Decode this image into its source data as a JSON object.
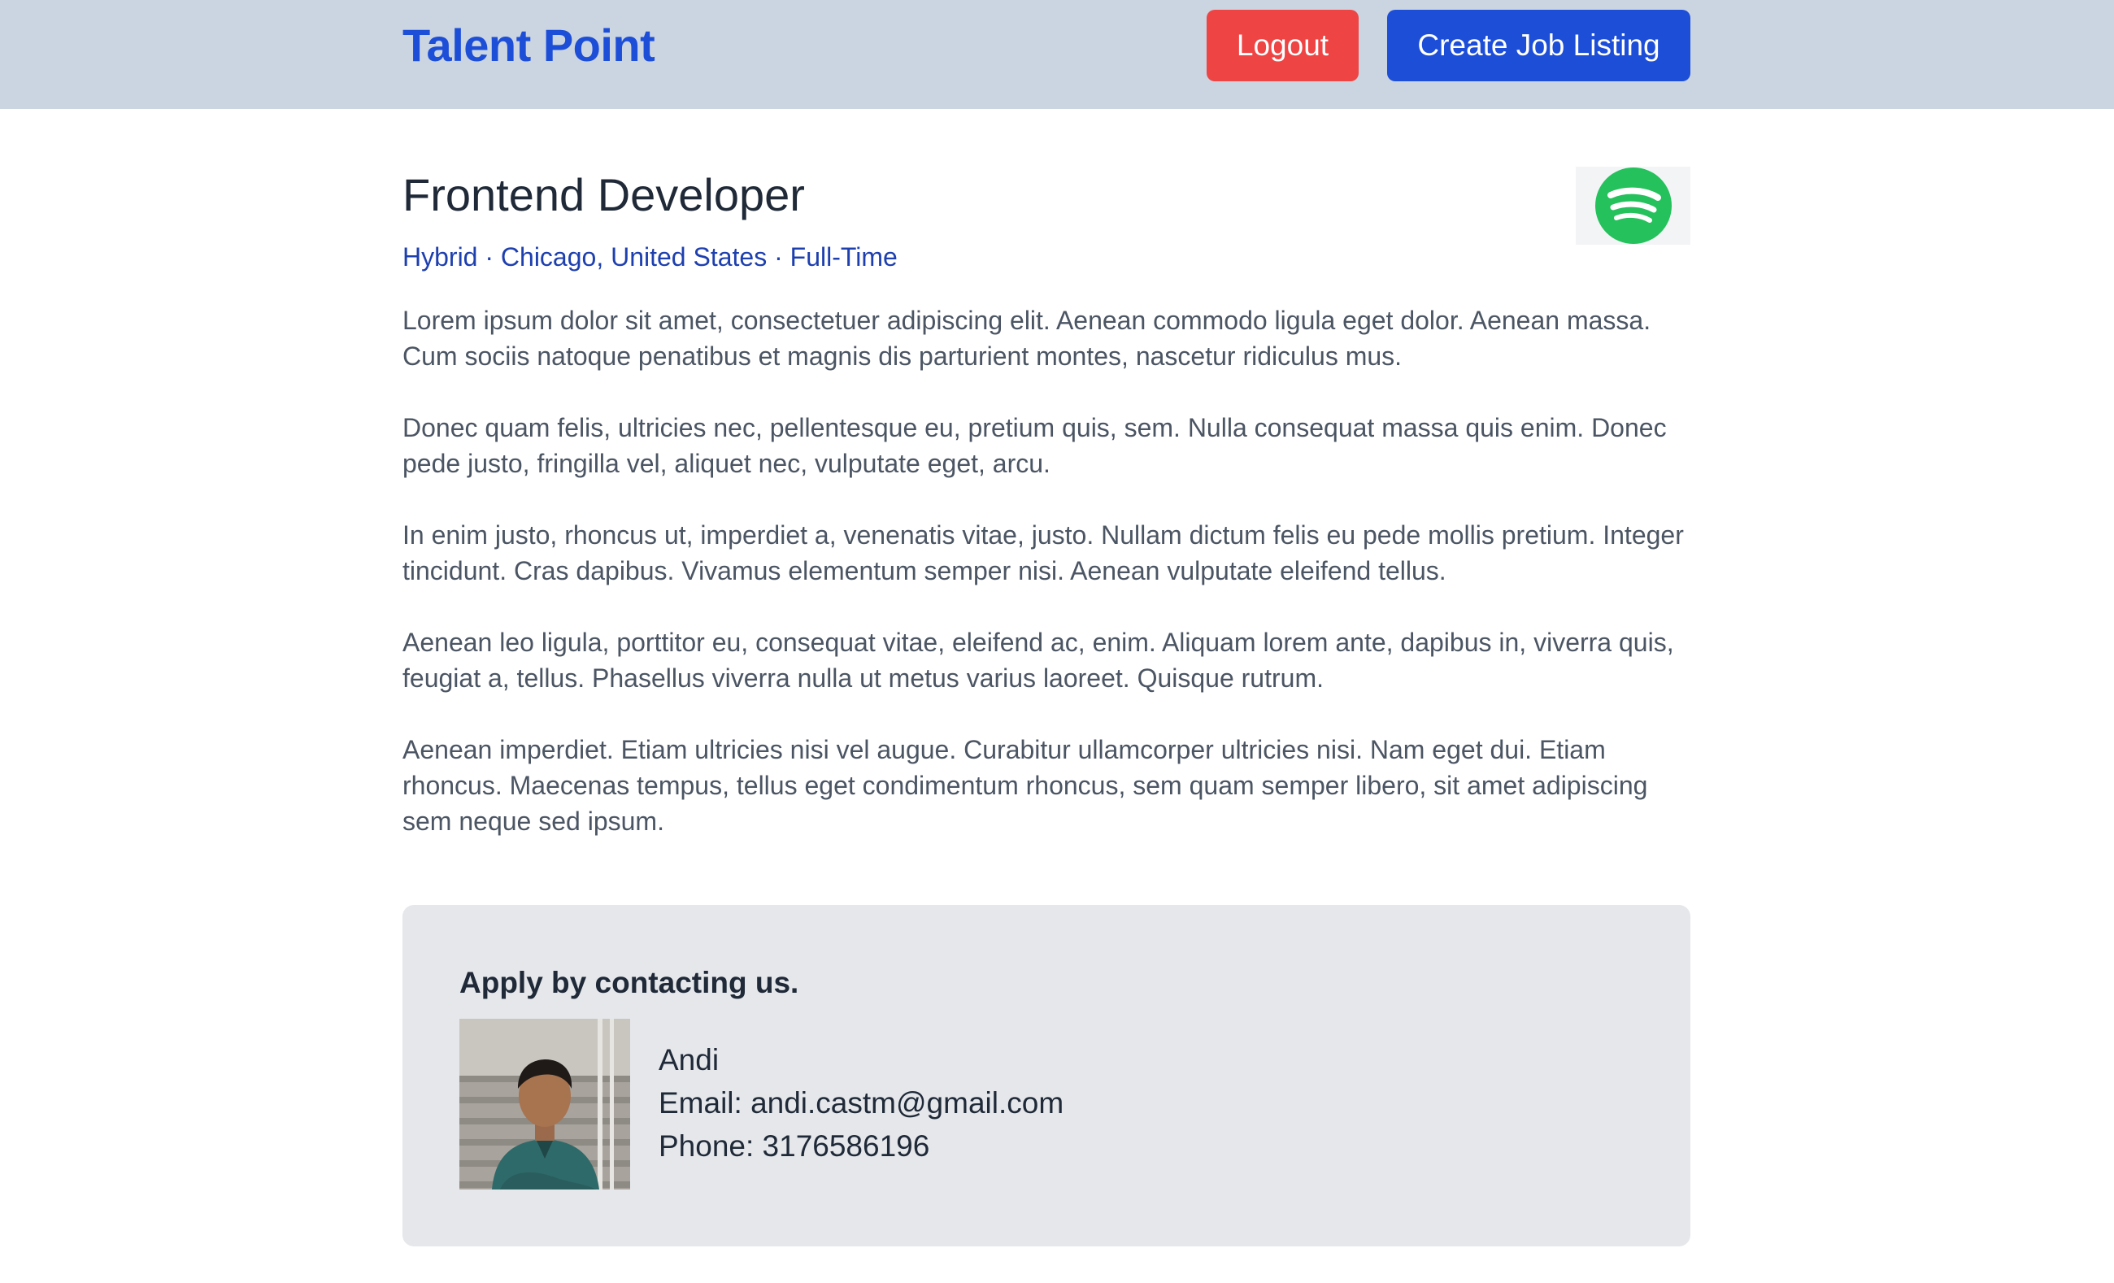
{
  "header": {
    "brand": "Talent Point",
    "logout_label": "Logout",
    "create_label": "Create Job Listing"
  },
  "job": {
    "title": "Frontend Developer",
    "meta": "Hybrid · Chicago, United States · Full-Time",
    "company_logo_icon": "spotify-logo-icon",
    "paragraphs": [
      "Lorem ipsum dolor sit amet, consectetuer adipiscing elit. Aenean commodo ligula eget dolor. Aenean massa. Cum sociis natoque penatibus et magnis dis parturient montes, nascetur ridiculus mus.",
      "Donec quam felis, ultricies nec, pellentesque eu, pretium quis, sem. Nulla consequat massa quis enim. Donec pede justo, fringilla vel, aliquet nec, vulputate eget, arcu.",
      "In enim justo, rhoncus ut, imperdiet a, venenatis vitae, justo. Nullam dictum felis eu pede mollis pretium. Integer tincidunt. Cras dapibus. Vivamus elementum semper nisi. Aenean vulputate eleifend tellus.",
      "Aenean leo ligula, porttitor eu, consequat vitae, eleifend ac, enim. Aliquam lorem ante, dapibus in, viverra quis, feugiat a, tellus. Phasellus viverra nulla ut metus varius laoreet. Quisque rutrum.",
      "Aenean imperdiet. Etiam ultricies nisi vel augue. Curabitur ullamcorper ultricies nisi. Nam eget dui. Etiam rhoncus. Maecenas tempus, tellus eget condimentum rhoncus, sem quam semper libero, sit amet adipiscing sem neque sed ipsum."
    ]
  },
  "contact": {
    "heading": "Apply by contacting us.",
    "name": "Andi",
    "email": "Email: andi.castm@gmail.com",
    "phone": "Phone: 3176586196"
  },
  "colors": {
    "navbar_bg": "#cbd5e1",
    "brand": "#1d4ed8",
    "logout": "#ef4444",
    "create": "#1d4ed8",
    "meta": "#1e40af",
    "spotify_green": "#1ed760"
  }
}
